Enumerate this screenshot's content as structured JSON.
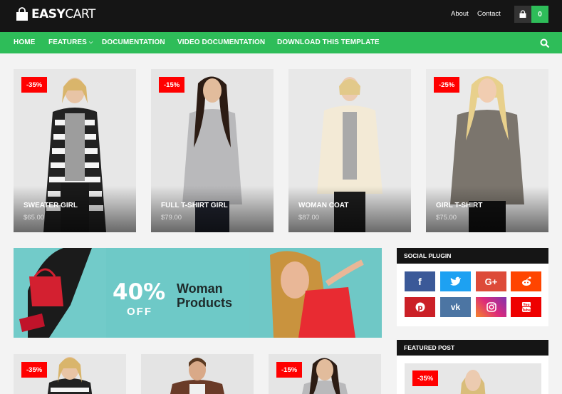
{
  "header": {
    "logo_bold": "EASY",
    "logo_light": "CART",
    "links": [
      "About",
      "Contact"
    ],
    "cart_count": "0"
  },
  "nav": {
    "items": [
      "HOME",
      "FEATURES",
      "DOCUMENTATION",
      "VIDEO DOCUMENTATION",
      "DOWNLOAD THIS TEMPLATE"
    ]
  },
  "products": [
    {
      "name": "SWEATER GIRL",
      "price": "$65.00",
      "discount": "-35%"
    },
    {
      "name": "FULL T-SHIRT GIRL",
      "price": "$79.00",
      "discount": "-15%"
    },
    {
      "name": "WOMAN COAT",
      "price": "$87.00",
      "discount": ""
    },
    {
      "name": "GIRL T-SHIRT",
      "price": "$75.00",
      "discount": "-25%"
    }
  ],
  "banner": {
    "percent": "40%",
    "off": "OFF",
    "line1": "Woman",
    "line2": "Products"
  },
  "sidebar": {
    "social_title": "SOCIAL PLUGIN",
    "featured_title": "FEATURED POST",
    "featured_badge": "-35%",
    "social_buttons": [
      {
        "icon": "facebook-icon",
        "glyph": "f",
        "color": "#3b5998"
      },
      {
        "icon": "twitter-icon",
        "glyph": "t",
        "color": "#1da1f2"
      },
      {
        "icon": "google-plus-icon",
        "glyph": "G+",
        "color": "#dd4b39"
      },
      {
        "icon": "reddit-icon",
        "glyph": "r",
        "color": "#ff4500"
      },
      {
        "icon": "pinterest-icon",
        "glyph": "p",
        "color": "#cb2027"
      },
      {
        "icon": "vk-icon",
        "glyph": "vk",
        "color": "#4c75a3"
      },
      {
        "icon": "instagram-icon",
        "glyph": "◎",
        "color": "#d6249f"
      },
      {
        "icon": "youtube-icon",
        "glyph": "▶",
        "color": "#e00"
      }
    ]
  },
  "bottom_products": [
    {
      "discount": "-35%"
    },
    {
      "discount": ""
    },
    {
      "discount": "-15%"
    }
  ],
  "colors": {
    "accent": "#2ebd59",
    "header_bg": "#151515",
    "badge": "#ff0000"
  }
}
